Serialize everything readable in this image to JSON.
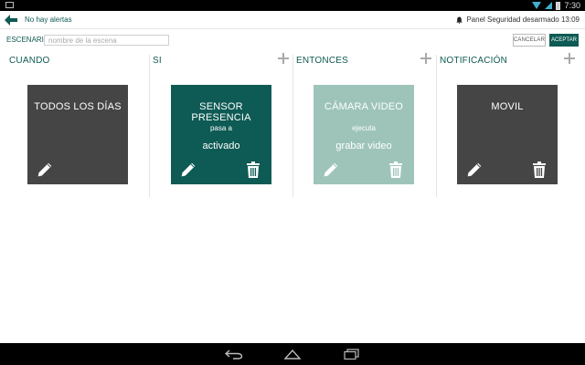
{
  "status_bar": {
    "time": "7:30"
  },
  "header": {
    "alerts": "No hay alertas",
    "panel_status": "Panel Seguridad desarmado 13:09"
  },
  "scene": {
    "label": "ESCENARIO:",
    "placeholder": "nombre de la escena",
    "value": ""
  },
  "buttons": {
    "cancel": "CANCELAR",
    "accept": "ACEPTAR"
  },
  "columns": [
    {
      "title": "CUANDO",
      "has_add": false,
      "card": {
        "title": "TODOS LOS DÍAS",
        "subtitle": "",
        "value": "",
        "has_delete": false,
        "color": "#454545"
      }
    },
    {
      "title": "SI",
      "has_add": true,
      "card": {
        "title": "SENSOR PRESENCIA",
        "subtitle": "pasa a",
        "value": "activado",
        "has_delete": true,
        "color": "#0e5a54"
      }
    },
    {
      "title": "ENTONCES",
      "has_add": true,
      "card": {
        "title": "CÁMARA VIDEO",
        "subtitle": "ejecuta",
        "value": "grabar video",
        "has_delete": true,
        "color": "#9ec4ba"
      }
    },
    {
      "title": "NOTIFICACIÓN",
      "has_add": true,
      "card": {
        "title": "MOVIL",
        "subtitle": "",
        "value": "",
        "has_delete": true,
        "color": "#454545"
      }
    }
  ],
  "colors": {
    "accent": "#0e5a54",
    "card_dark": "#454545",
    "card_light": "#9ec4ba"
  },
  "icons": [
    "back-icon",
    "bell-icon",
    "add-icon",
    "edit-icon",
    "trash-icon",
    "nav-back-icon",
    "nav-home-icon",
    "nav-recents-icon"
  ]
}
